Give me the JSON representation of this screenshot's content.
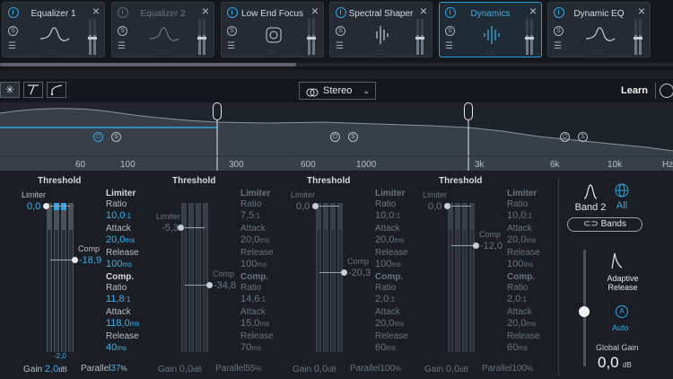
{
  "modules": [
    {
      "title": "Equalizer 1",
      "state": "normal"
    },
    {
      "title": "Equalizer 2",
      "state": "bypassed"
    },
    {
      "title": "Low End Focus",
      "state": "normal"
    },
    {
      "title": "Spectral Shaper",
      "state": "normal"
    },
    {
      "title": "Dynamics",
      "state": "active"
    },
    {
      "title": "Dynamic EQ",
      "state": "normal"
    }
  ],
  "toolbar": {
    "stereo_label": "Stereo",
    "learn_label": "Learn"
  },
  "spectrum": {
    "frequency_labels": [
      "60",
      "100",
      "300",
      "600",
      "1000",
      "3k",
      "6k",
      "10k",
      "Hz"
    ]
  },
  "bands": [
    {
      "threshold_label": "Threshold",
      "limiter_label": "Limiter",
      "limiter_value": "0,0",
      "comp_label": "Comp",
      "comp_value": "-18,9",
      "meter_bottom_value": "-2,0",
      "gain_label": "Gain",
      "gain_value": "2,0",
      "gain_unit": "dB",
      "parallel_label": "Parallel",
      "parallel_value": "37",
      "parallel_unit": "%",
      "limiter_section": "Limiter",
      "limiter_ratio_label": "Ratio",
      "limiter_ratio": "10,0",
      "limiter_ratio_unit": ":1",
      "limiter_attack_label": "Attack",
      "limiter_attack": "20,0",
      "limiter_attack_unit": "ms",
      "limiter_release_label": "Release",
      "limiter_release": "100",
      "limiter_release_unit": "ms",
      "comp_section": "Comp.",
      "comp_ratio_label": "Ratio",
      "comp_ratio": "11,8",
      "comp_ratio_unit": ":1",
      "comp_attack_label": "Attack",
      "comp_attack": "118,0",
      "comp_attack_unit": "ms",
      "comp_release_label": "Release",
      "comp_release": "40",
      "comp_release_unit": "ms"
    },
    {
      "threshold_label": "Threshold",
      "limiter_label": "Limiter",
      "limiter_value": "-5,3",
      "comp_label": "Comp",
      "comp_value": "-34,8",
      "gain_label": "Gain",
      "gain_value": "0,0",
      "gain_unit": "dB",
      "parallel_label": "Parallel",
      "parallel_value": "55",
      "parallel_unit": "%",
      "limiter_section": "Limiter",
      "limiter_ratio_label": "Ratio",
      "limiter_ratio": "7,5",
      "limiter_ratio_unit": ":1",
      "limiter_attack_label": "Attack",
      "limiter_attack": "20,0",
      "limiter_attack_unit": "ms",
      "limiter_release_label": "Release",
      "limiter_release": "100",
      "limiter_release_unit": "ms",
      "comp_section": "Comp.",
      "comp_ratio_label": "Ratio",
      "comp_ratio": "14,6",
      "comp_ratio_unit": ":1",
      "comp_attack_label": "Attack",
      "comp_attack": "15,0",
      "comp_attack_unit": "ms",
      "comp_release_label": "Release",
      "comp_release": "70",
      "comp_release_unit": "ms"
    },
    {
      "threshold_label": "Threshold",
      "limiter_label": "Limiter",
      "limiter_value": "0,0",
      "comp_label": "Comp",
      "comp_value": "-20,3",
      "gain_label": "Gain",
      "gain_value": "0,0",
      "gain_unit": "dB",
      "parallel_label": "Parallel",
      "parallel_value": "100",
      "parallel_unit": "%",
      "limiter_section": "Limiter",
      "limiter_ratio_label": "Ratio",
      "limiter_ratio": "10,0",
      "limiter_ratio_unit": ":1",
      "limiter_attack_label": "Attack",
      "limiter_attack": "20,0",
      "limiter_attack_unit": "ms",
      "limiter_release_label": "Release",
      "limiter_release": "100",
      "limiter_release_unit": "ms",
      "comp_section": "Comp.",
      "comp_ratio_label": "Ratio",
      "comp_ratio": "2,0",
      "comp_ratio_unit": ":1",
      "comp_attack_label": "Attack",
      "comp_attack": "20,0",
      "comp_attack_unit": "ms",
      "comp_release_label": "Release",
      "comp_release": "60",
      "comp_release_unit": "ms"
    },
    {
      "threshold_label": "Threshold",
      "limiter_label": "Limiter",
      "limiter_value": "0,0",
      "comp_label": "Comp",
      "comp_value": "-12,0",
      "gain_label": "Gain",
      "gain_value": "0,0",
      "gain_unit": "dB",
      "parallel_label": "Parallel",
      "parallel_value": "100",
      "parallel_unit": "%",
      "limiter_section": "Limiter",
      "limiter_ratio_label": "Ratio",
      "limiter_ratio": "10,0",
      "limiter_ratio_unit": ":1",
      "limiter_attack_label": "Attack",
      "limiter_attack": "20,0",
      "limiter_attack_unit": "ms",
      "limiter_release_label": "Release",
      "limiter_release": "100",
      "limiter_release_unit": "ms",
      "comp_section": "Comp.",
      "comp_ratio_label": "Ratio",
      "comp_ratio": "2,0",
      "comp_ratio_unit": ":1",
      "comp_attack_label": "Attack",
      "comp_attack": "20,0",
      "comp_attack_unit": "ms",
      "comp_release_label": "Release",
      "comp_release": "60",
      "comp_release_unit": "ms"
    }
  ],
  "right_panel": {
    "band_label": "Band 2",
    "all_label": "All",
    "bands_button": "Bands",
    "adaptive_release_label": "Adaptive Release",
    "auto_letter": "A",
    "auto_label": "Auto",
    "global_gain_label": "Global Gain",
    "global_gain_value": "0,0",
    "global_gain_unit": "dB"
  },
  "colors": {
    "accent": "#2ea6e6",
    "background": "#1b1f25",
    "text": "#c9ced6"
  }
}
